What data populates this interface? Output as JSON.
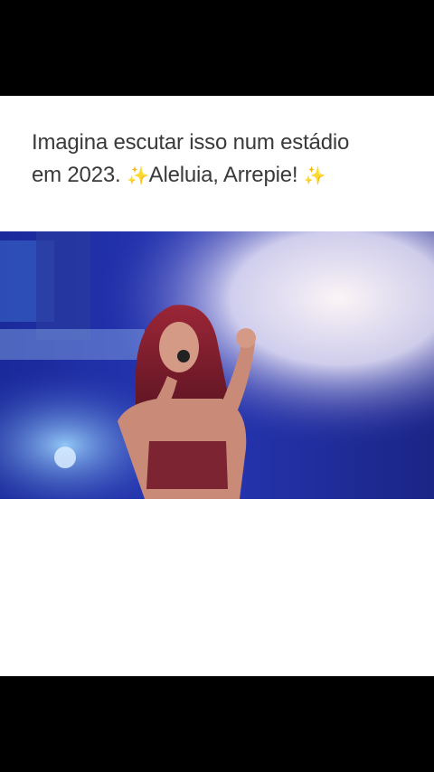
{
  "post": {
    "caption_line1": "Imagina escutar isso num estádio",
    "caption_line2_start": "em 2023.",
    "sparkle_1": "✨",
    "caption_line2_mid": "Aleluia, Arrepie!",
    "sparkle_2": "✨"
  },
  "media": {
    "description_icon": "concert-photo",
    "accent_colors": {
      "stage_blue": "#1f2fa8",
      "smoke_white": "#eef0ff",
      "hair_red": "#7a1d2a",
      "top_red": "#8a2a35"
    }
  }
}
